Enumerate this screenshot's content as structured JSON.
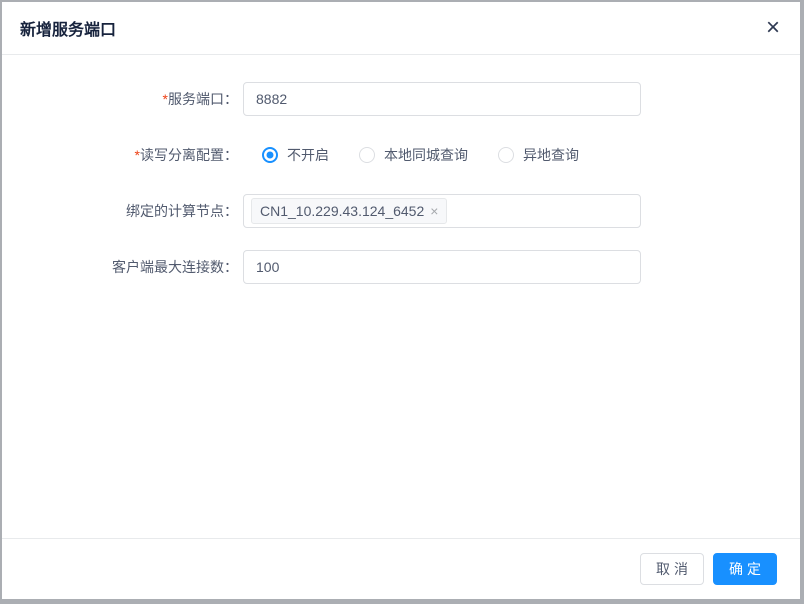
{
  "colors": {
    "primary": "#1890ff",
    "required": "#ed4014",
    "title_text": "#17233d",
    "label_text": "#515a6e",
    "border": "#dcdee2",
    "divider": "#e8eaec"
  },
  "dialog": {
    "title": "新增服务端口",
    "close_icon": "×"
  },
  "form": {
    "service_port": {
      "required": "*",
      "label": "服务端口：",
      "value": "8882"
    },
    "rw_split": {
      "required": "*",
      "label": "读写分离配置：",
      "options": [
        {
          "label": "不开启",
          "selected": true
        },
        {
          "label": "本地同城查询",
          "selected": false
        },
        {
          "label": "异地查询",
          "selected": false
        }
      ]
    },
    "bound_node": {
      "label": "绑定的计算节点：",
      "tag": "CN1_10.229.43.124_6452",
      "tag_remove_icon": "×"
    },
    "max_connections": {
      "label": "客户端最大连接数：",
      "value": "100"
    }
  },
  "footer": {
    "cancel_label": "取消",
    "confirm_label": "确定"
  }
}
